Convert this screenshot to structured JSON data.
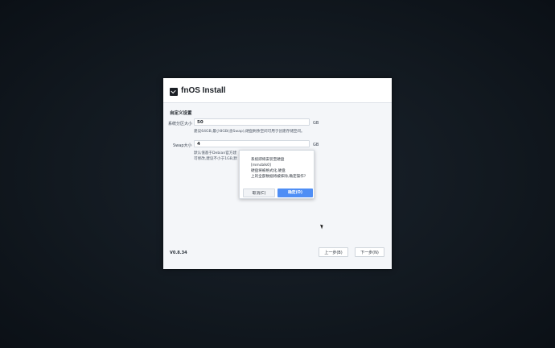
{
  "window": {
    "title": "fnOS Install",
    "logo_icon": "fnos-logo-icon"
  },
  "section": {
    "title": "自定义设置"
  },
  "fields": [
    {
      "label": "系统分区大小",
      "value": "50",
      "unit": "GB",
      "hint_lines": [
        "建议64GB,最小8GB(含Swap),硬盘剩余空间可用于创建存储空间。"
      ]
    },
    {
      "label": "Swap大小",
      "value": "4",
      "unit": "GB",
      "hint_lines": [
        "默认值基于Debian官方建",
        "可修改,建议不小于1GB,默"
      ]
    }
  ],
  "dialog": {
    "message_lines": [
      "系统即将安装至硬盘",
      "[mmcblk0]",
      "硬盘将被格式化,硬盘",
      "上的全部数据将被抹除,确定操作?"
    ],
    "cancel_label": "取消(C)",
    "ok_label": "确定(O)"
  },
  "footer": {
    "version": "V0.8.34",
    "prev_label": "上一步(B)",
    "next_label": "下一步(N)"
  },
  "colors": {
    "accent": "#4f8ef5",
    "background": "#10161d",
    "panel": "#f4f6f9"
  }
}
